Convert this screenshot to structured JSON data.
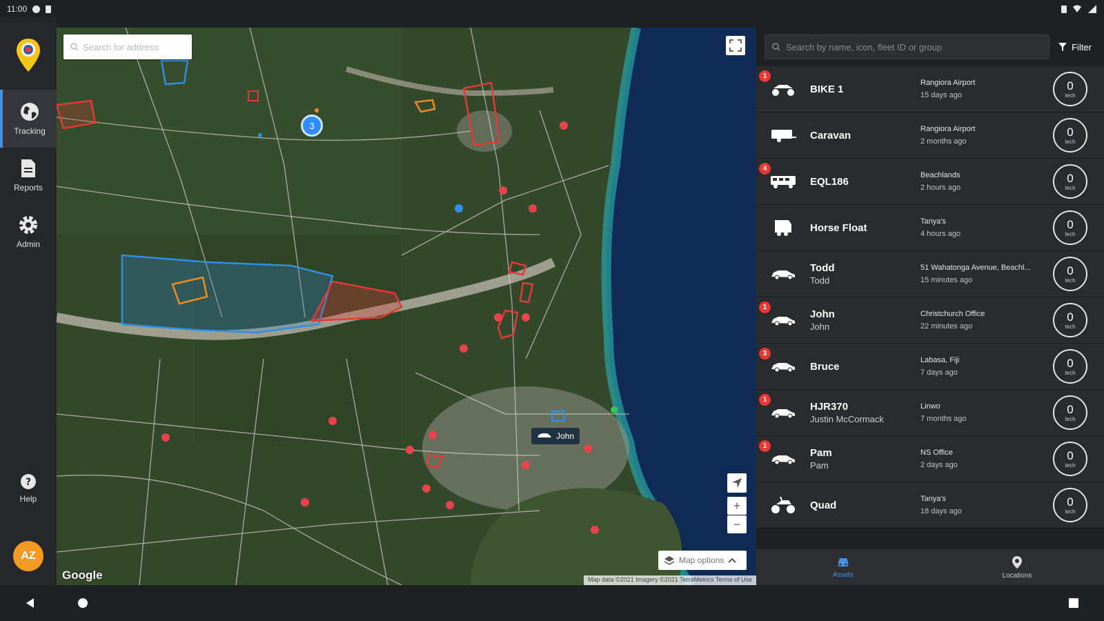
{
  "status": {
    "time": "11:00"
  },
  "sidebar": {
    "items": [
      {
        "label": "Tracking",
        "icon": "globe-icon"
      },
      {
        "label": "Reports",
        "icon": "report-icon"
      },
      {
        "label": "Admin",
        "icon": "gear-icon"
      }
    ],
    "help_label": "Help",
    "avatar_initials": "AZ"
  },
  "map": {
    "search_placeholder": "Search for address",
    "cluster_count": "3",
    "marker_label": "John",
    "map_options_label": "Map options",
    "google_label": "Google",
    "attribution": "Map data ©2021 Imagery ©2021 TerraMetrics  Terms of Use",
    "zoom_in": "+",
    "zoom_out": "−"
  },
  "panel": {
    "search_placeholder": "Search by name, icon, fleet ID or group",
    "filter_label": "Filter",
    "assets": [
      {
        "name": "BIKE 1",
        "sub": "",
        "location": "Rangiora Airport",
        "ago": "15 days ago",
        "count": "0",
        "count_label": "tech",
        "badge": "1",
        "icon": "atv-icon"
      },
      {
        "name": "Caravan",
        "sub": "",
        "location": "Rangiora Airport",
        "ago": "2 months ago",
        "count": "0",
        "count_label": "tech",
        "badge": "",
        "icon": "caravan-icon"
      },
      {
        "name": "EQL186",
        "sub": "",
        "location": "Beachlands",
        "ago": "2 hours ago",
        "count": "0",
        "count_label": "tech",
        "badge": "4",
        "icon": "bus-icon"
      },
      {
        "name": "Horse Float",
        "sub": "",
        "location": "Tanya's",
        "ago": "4 hours ago",
        "count": "0",
        "count_label": "tech",
        "badge": "",
        "icon": "float-icon"
      },
      {
        "name": "Todd",
        "sub": "Todd",
        "location": "51 Wahatonga Avenue, Beachl...",
        "ago": "15 minutes ago",
        "count": "0",
        "count_label": "tech",
        "badge": "",
        "icon": "car-icon"
      },
      {
        "name": "John",
        "sub": "John",
        "location": "Christchurch Office",
        "ago": "22 minutes ago",
        "count": "0",
        "count_label": "tech",
        "badge": "1",
        "icon": "car-icon"
      },
      {
        "name": "Bruce",
        "sub": "",
        "location": "Labasa, Fiji",
        "ago": "7 days ago",
        "count": "0",
        "count_label": "tech",
        "badge": "3",
        "icon": "car-icon"
      },
      {
        "name": "HJR370",
        "sub": "Justin McCormack",
        "location": "Linwo",
        "ago": "7 months ago",
        "count": "0",
        "count_label": "tech",
        "badge": "1",
        "icon": "car-icon"
      },
      {
        "name": "Pam",
        "sub": "Pam",
        "location": "NS Office",
        "ago": "2 days ago",
        "count": "0",
        "count_label": "tech",
        "badge": "1",
        "icon": "car-icon"
      },
      {
        "name": "Quad",
        "sub": "",
        "location": "Tanya's",
        "ago": "18 days ago",
        "count": "0",
        "count_label": "tech",
        "badge": "",
        "icon": "quad-icon"
      }
    ],
    "tabs": [
      {
        "label": "Assets",
        "icon": "car-icon"
      },
      {
        "label": "Locations",
        "icon": "pin-icon"
      }
    ]
  },
  "colors": {
    "accent": "#4a90e2",
    "badge": "#e53935",
    "avatar": "#f29a21",
    "geofence_red": "#e53935",
    "geofence_blue": "#2f8fe6",
    "geofence_orange": "#f08c1f"
  }
}
